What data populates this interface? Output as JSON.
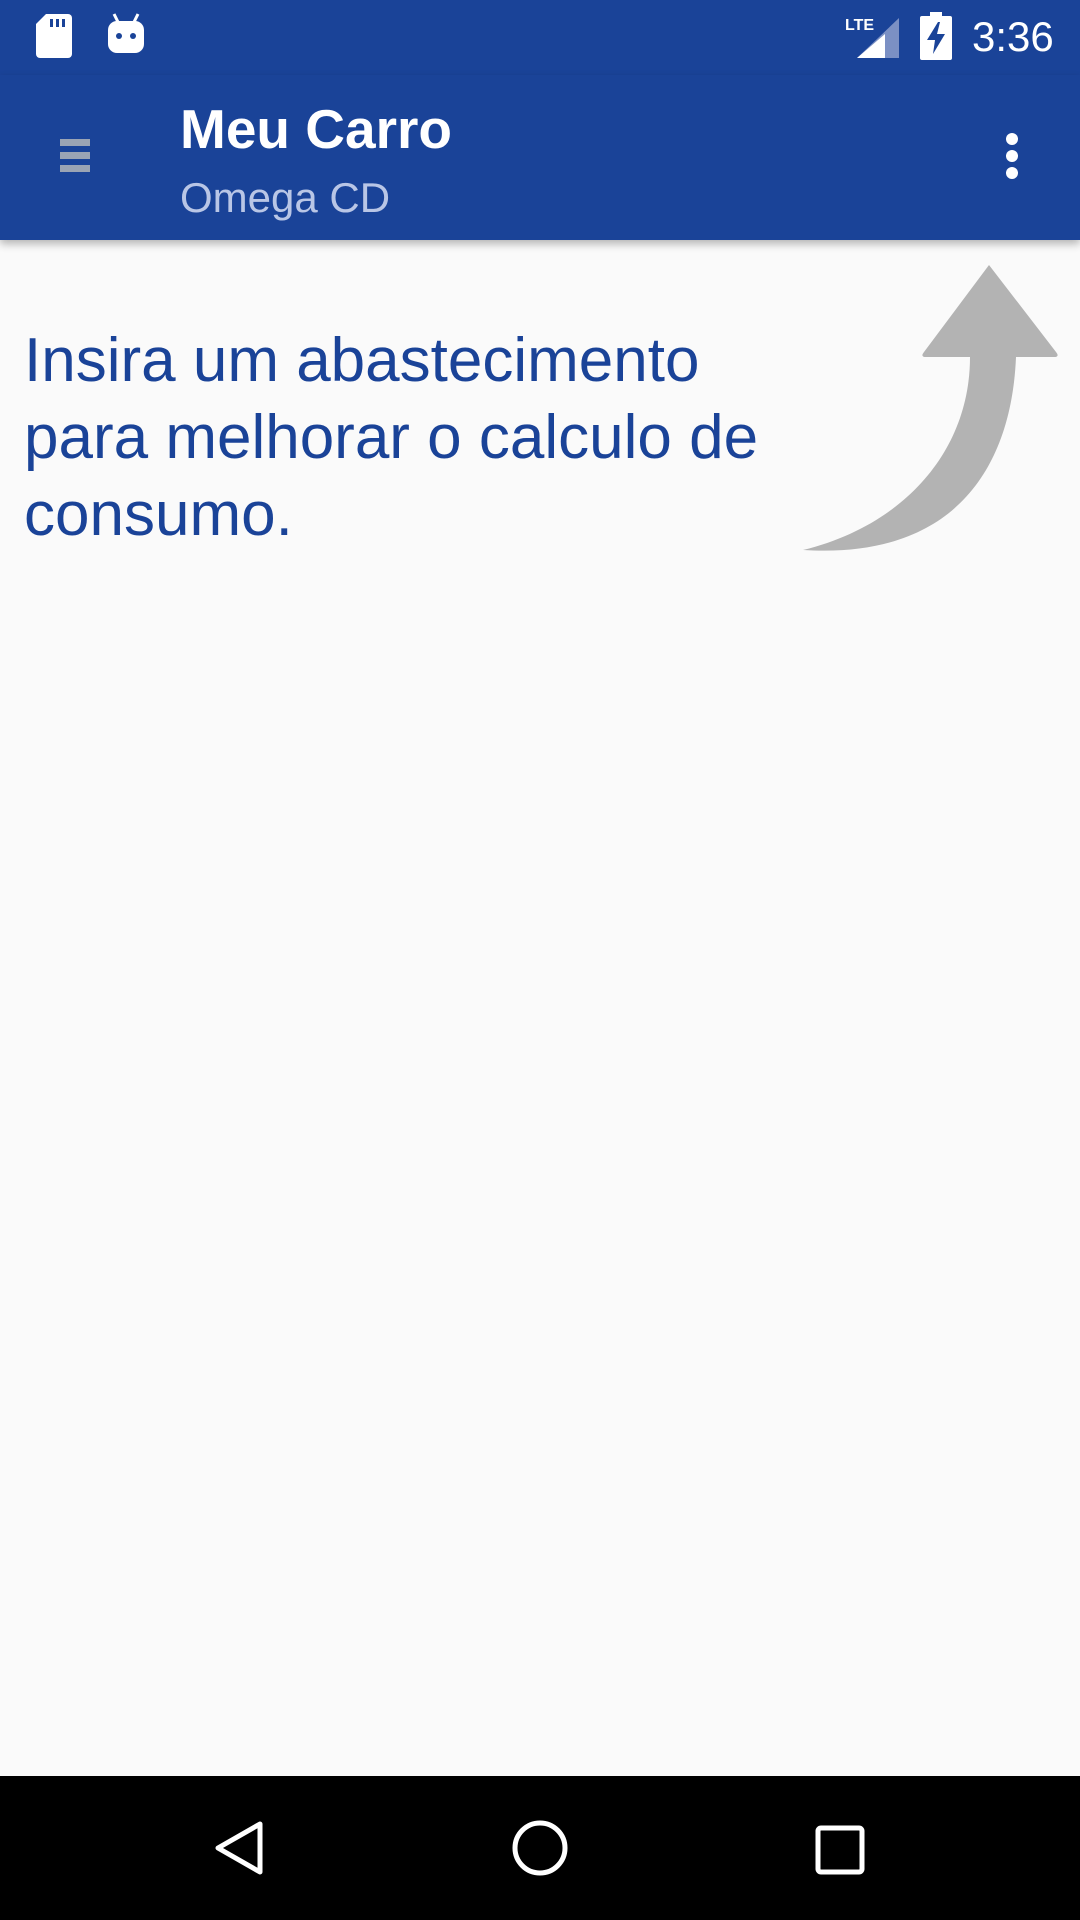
{
  "status_bar": {
    "time": "3:36",
    "network_label": "LTE",
    "icons": [
      "sd-card-icon",
      "android-icon",
      "lte-signal-icon",
      "battery-charging-icon"
    ]
  },
  "app_bar": {
    "title": "Meu Carro",
    "subtitle": "Omega CD",
    "background": "#1a4398",
    "subtitle_color": "#b9c6e6",
    "icons": [
      "menu-icon",
      "overflow-menu-icon"
    ]
  },
  "content": {
    "hint": "Insira um abastecimento para melhorar o calculo de consumo.",
    "hint_color": "#1a4398",
    "arrow_color": "#b3b3b3",
    "icons": [
      "curved-arrow-icon"
    ]
  },
  "nav_bar": {
    "icons": [
      "back-icon",
      "home-icon",
      "recents-icon"
    ]
  }
}
